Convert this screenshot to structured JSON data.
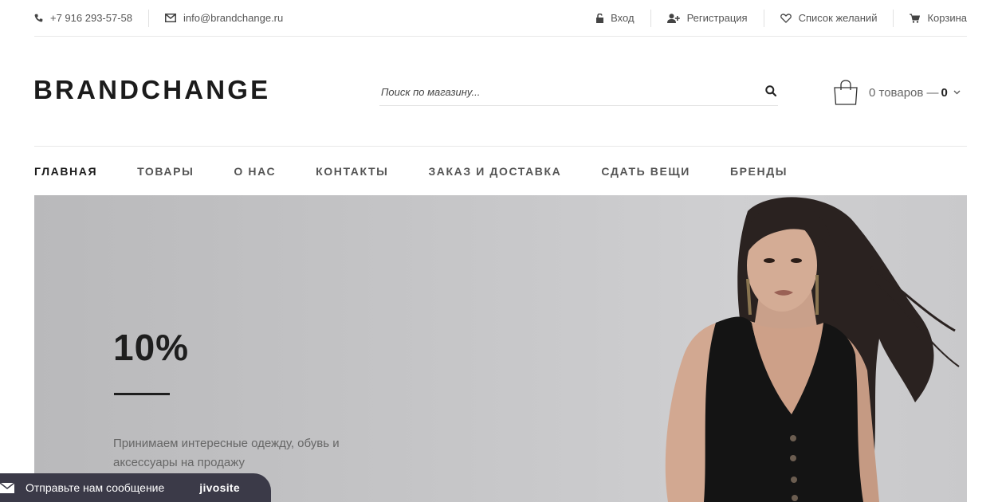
{
  "topbar": {
    "phone": "+7 916 293-57-58",
    "email": "info@brandchange.ru",
    "login": "Вход",
    "register": "Регистрация",
    "wishlist": "Список желаний",
    "cart": "Корзина"
  },
  "header": {
    "logo": "BRANDCHANGE",
    "search_placeholder": "Поиск по магазину...",
    "cart_count_text": "0 товаров —",
    "cart_total": "0"
  },
  "nav": {
    "items": [
      "ГЛАВНАЯ",
      "ТОВАРЫ",
      "О НАС",
      "КОНТАКТЫ",
      "ЗАКАЗ И ДОСТАВКА",
      "СДАТЬ ВЕЩИ",
      "БРЕНДЫ"
    ]
  },
  "hero": {
    "title": "10%",
    "text": "Принимаем интересные одежду, обувь и аксессуары на продажу"
  },
  "chat": {
    "label": "Отправьте нам сообщение",
    "brand": "jivosite"
  },
  "colors": {
    "text_dark": "#1b1b1b",
    "chat_bg": "#3b3a48",
    "hero_bg": "#c6c6c8"
  }
}
